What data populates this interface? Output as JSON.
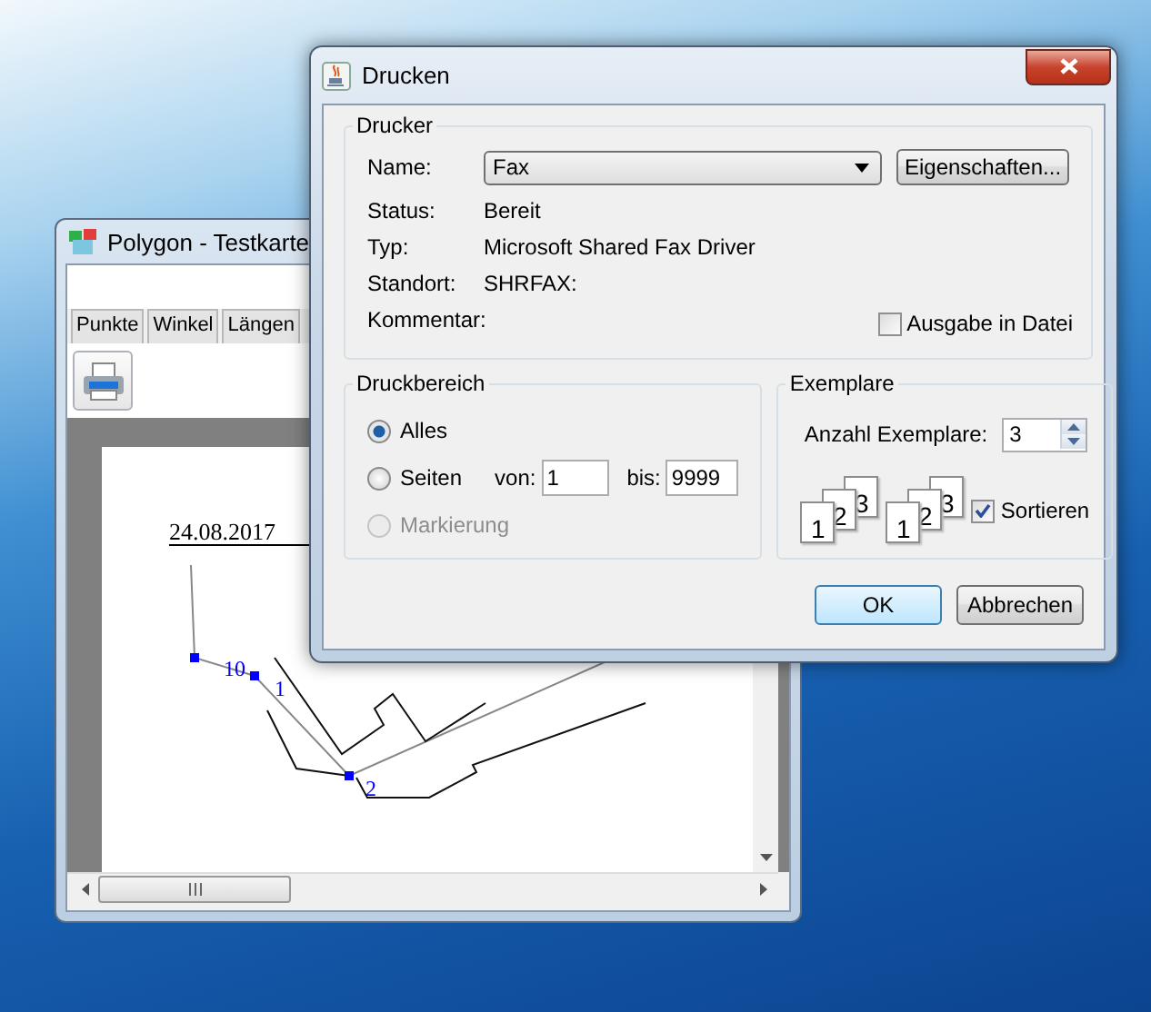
{
  "background_window": {
    "title": "Polygon - Testkarte",
    "tabs": [
      {
        "label": "Punkte",
        "selected": false
      },
      {
        "label": "Winkel",
        "selected": false
      },
      {
        "label": "Längen",
        "selected": false
      }
    ],
    "page": {
      "date": "24.08.2017",
      "point_labels": [
        "10",
        "1",
        "2"
      ]
    }
  },
  "dialog": {
    "title": "Drucken",
    "printer": {
      "legend": "Drucker",
      "name_label": "Name:",
      "name_value": "Fax",
      "properties_button": "Eigenschaften...",
      "info": [
        {
          "label": "Status:",
          "value": "Bereit"
        },
        {
          "label": "Typ:",
          "value": "Microsoft Shared Fax Driver"
        },
        {
          "label": "Standort:",
          "value": "SHRFAX:"
        },
        {
          "label": "Kommentar:"
        }
      ],
      "print_to_file": {
        "label": "Ausgabe in Datei",
        "checked": false
      }
    },
    "range": {
      "legend": "Druckbereich",
      "options": [
        {
          "label": "Alles",
          "selected": true,
          "disabled": false
        },
        {
          "label": "Seiten",
          "selected": false,
          "disabled": false
        },
        {
          "label": "Markierung",
          "selected": false,
          "disabled": true
        }
      ],
      "from_label": "von:",
      "from_value": "1",
      "to_label": "bis:",
      "to_value": "9999"
    },
    "copies": {
      "legend": "Exemplare",
      "count_label": "Anzahl Exemplare:",
      "count_value": "3",
      "collate_stacks": [
        {
          "pages": [
            "1",
            "2",
            "3"
          ]
        },
        {
          "pages": [
            "1",
            "2",
            "3"
          ]
        }
      ],
      "collate": {
        "label": "Sortieren",
        "checked": true
      }
    },
    "buttons": [
      {
        "label": "OK",
        "default": true
      },
      {
        "label": "Abbrechen",
        "default": false
      }
    ]
  }
}
